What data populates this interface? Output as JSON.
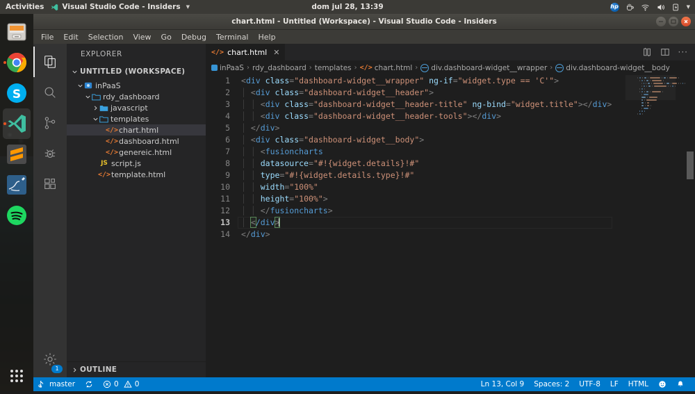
{
  "desktop": {
    "topbar": {
      "activities": "Activities",
      "app_name": "Visual Studio Code - Insiders",
      "app_icon": "vscode-icon",
      "caret_icon": "chevron-down-icon",
      "clock": "dom jul 28, 13:39",
      "indicators": [
        {
          "name": "hp-logo-icon",
          "label": "hp"
        },
        {
          "name": "coffee-cup-icon",
          "label": ""
        },
        {
          "name": "wifi-icon",
          "label": ""
        },
        {
          "name": "volume-icon",
          "label": ""
        },
        {
          "name": "battery-icon",
          "label": ""
        },
        {
          "name": "chevron-down-icon",
          "label": ""
        }
      ]
    },
    "dock": {
      "items": [
        {
          "name": "files-nautilus",
          "label": "Files",
          "active": false,
          "running": false
        },
        {
          "name": "google-chrome",
          "label": "Google Chrome",
          "active": false,
          "running": true
        },
        {
          "name": "skype",
          "label": "Skype",
          "active": false,
          "running": false
        },
        {
          "name": "visual-studio-code-insiders",
          "label": "Visual Studio Code - Insiders",
          "active": true,
          "running": true
        },
        {
          "name": "sublime-text",
          "label": "Sublime Text",
          "active": false,
          "running": false
        },
        {
          "name": "mysql-workbench",
          "label": "MySQL Workbench",
          "active": false,
          "running": false
        },
        {
          "name": "spotify",
          "label": "Spotify",
          "active": false,
          "running": false
        }
      ],
      "show_apps_label": "Show Applications"
    }
  },
  "window": {
    "title": "chart.html - Untitled (Workspace) - Visual Studio Code - Insiders",
    "controls": {
      "minimize": "–",
      "maximize": "□",
      "close": "×"
    }
  },
  "menubar": {
    "items": [
      "File",
      "Edit",
      "Selection",
      "View",
      "Go",
      "Debug",
      "Terminal",
      "Help"
    ]
  },
  "activitybar": {
    "items": [
      {
        "name": "explorer",
        "icon": "files-icon",
        "active": true
      },
      {
        "name": "search",
        "icon": "search-icon",
        "active": false
      },
      {
        "name": "source-control",
        "icon": "source-control-icon",
        "active": false
      },
      {
        "name": "debug",
        "icon": "debug-icon",
        "active": false
      },
      {
        "name": "extensions",
        "icon": "extensions-icon",
        "active": false
      }
    ],
    "manage": {
      "icon": "gear-icon",
      "badge": "1"
    }
  },
  "sidebar": {
    "title": "EXPLORER",
    "workspace": {
      "label": "UNTITLED (WORKSPACE)",
      "expanded": true
    },
    "tree": [
      {
        "label": "inPaaS",
        "depth": 1,
        "type": "project",
        "expanded": true,
        "selected": false
      },
      {
        "label": "rdy_dashboard",
        "depth": 2,
        "type": "folder",
        "expanded": true,
        "selected": false
      },
      {
        "label": "javascript",
        "depth": 3,
        "type": "folder",
        "expanded": false,
        "selected": false
      },
      {
        "label": "templates",
        "depth": 3,
        "type": "folder",
        "expanded": true,
        "selected": false
      },
      {
        "label": "chart.html",
        "depth": 4,
        "type": "html",
        "expanded": null,
        "selected": true
      },
      {
        "label": "dashboard.html",
        "depth": 4,
        "type": "html",
        "expanded": null,
        "selected": false
      },
      {
        "label": "genereic.html",
        "depth": 4,
        "type": "html",
        "expanded": null,
        "selected": false
      },
      {
        "label": "script.js",
        "depth": 3,
        "type": "js",
        "expanded": null,
        "selected": false
      },
      {
        "label": "template.html",
        "depth": 3,
        "type": "html",
        "expanded": null,
        "selected": false
      }
    ],
    "outline": {
      "label": "OUTLINE",
      "expanded": false
    }
  },
  "editor": {
    "tabs": [
      {
        "label": "chart.html",
        "icon": "html-file-icon",
        "active": true,
        "close_icon": "close-icon"
      }
    ],
    "actions": [
      {
        "name": "split-editor-orientation-icon"
      },
      {
        "name": "split-editor-icon"
      },
      {
        "name": "more-actions-icon",
        "label": "···"
      }
    ],
    "breadcrumbs": [
      {
        "label": "inPaaS",
        "icon": "project-icon"
      },
      {
        "label": "rdy_dashboard",
        "icon": ""
      },
      {
        "label": "templates",
        "icon": ""
      },
      {
        "label": "chart.html",
        "icon": "html-file-icon"
      },
      {
        "label": "div.dashboard-widget__wrapper",
        "icon": "symbol-field-icon"
      },
      {
        "label": "div.dashboard-widget__body",
        "icon": "symbol-field-icon"
      }
    ],
    "lines": [
      {
        "n": "1",
        "indent": 0,
        "tokens": [
          [
            "pun",
            "<"
          ],
          [
            "tag",
            "div"
          ],
          [
            "txt",
            " "
          ],
          [
            "attr",
            "class"
          ],
          [
            "pun",
            "="
          ],
          [
            "str",
            "\"dashboard-widget__wrapper\""
          ],
          [
            "txt",
            " "
          ],
          [
            "attr",
            "ng-if"
          ],
          [
            "pun",
            "="
          ],
          [
            "str",
            "\"widget.type == 'C'\""
          ],
          [
            "pun",
            ">"
          ]
        ]
      },
      {
        "n": "2",
        "indent": 1,
        "tokens": [
          [
            "pun",
            "<"
          ],
          [
            "tag",
            "div"
          ],
          [
            "txt",
            " "
          ],
          [
            "attr",
            "class"
          ],
          [
            "pun",
            "="
          ],
          [
            "str",
            "\"dashboard-widget__header\""
          ],
          [
            "pun",
            ">"
          ]
        ]
      },
      {
        "n": "3",
        "indent": 2,
        "tokens": [
          [
            "pun",
            "<"
          ],
          [
            "tag",
            "div"
          ],
          [
            "txt",
            " "
          ],
          [
            "attr",
            "class"
          ],
          [
            "pun",
            "="
          ],
          [
            "str",
            "\"dashboard-widget__header-title\""
          ],
          [
            "txt",
            " "
          ],
          [
            "attr",
            "ng-bind"
          ],
          [
            "pun",
            "="
          ],
          [
            "str",
            "\"widget.title\""
          ],
          [
            "pun",
            ">"
          ],
          [
            "pun",
            "</"
          ],
          [
            "tag",
            "div"
          ],
          [
            "pun",
            ">"
          ]
        ]
      },
      {
        "n": "4",
        "indent": 2,
        "tokens": [
          [
            "pun",
            "<"
          ],
          [
            "tag",
            "div"
          ],
          [
            "txt",
            " "
          ],
          [
            "attr",
            "class"
          ],
          [
            "pun",
            "="
          ],
          [
            "str",
            "\"dashboard-widget__header-tools\""
          ],
          [
            "pun",
            ">"
          ],
          [
            "pun",
            "</"
          ],
          [
            "tag",
            "div"
          ],
          [
            "pun",
            ">"
          ]
        ]
      },
      {
        "n": "5",
        "indent": 1,
        "tokens": [
          [
            "pun",
            "</"
          ],
          [
            "tag",
            "div"
          ],
          [
            "pun",
            ">"
          ]
        ]
      },
      {
        "n": "6",
        "indent": 1,
        "tokens": [
          [
            "pun",
            "<"
          ],
          [
            "tag",
            "div"
          ],
          [
            "txt",
            " "
          ],
          [
            "attr",
            "class"
          ],
          [
            "pun",
            "="
          ],
          [
            "str",
            "\"dashboard-widget__body\""
          ],
          [
            "pun",
            ">"
          ]
        ]
      },
      {
        "n": "7",
        "indent": 2,
        "tokens": [
          [
            "pun",
            "<"
          ],
          [
            "tag",
            "fusioncharts"
          ]
        ]
      },
      {
        "n": "8",
        "indent": 2,
        "tokens": [
          [
            "attr",
            "datasource"
          ],
          [
            "pun",
            "="
          ],
          [
            "str",
            "\"#!{widget.details}!#\""
          ]
        ]
      },
      {
        "n": "9",
        "indent": 2,
        "tokens": [
          [
            "attr",
            "type"
          ],
          [
            "pun",
            "="
          ],
          [
            "str",
            "\"#!{widget.details.type}!#\""
          ]
        ]
      },
      {
        "n": "10",
        "indent": 2,
        "tokens": [
          [
            "attr",
            "width"
          ],
          [
            "pun",
            "="
          ],
          [
            "str",
            "\"100%\""
          ]
        ]
      },
      {
        "n": "11",
        "indent": 2,
        "tokens": [
          [
            "attr",
            "height"
          ],
          [
            "pun",
            "="
          ],
          [
            "str",
            "\"100%\""
          ],
          [
            "pun",
            ">"
          ]
        ]
      },
      {
        "n": "12",
        "indent": 2,
        "tokens": [
          [
            "pun",
            "</"
          ],
          [
            "tag",
            "fusioncharts"
          ],
          [
            "pun",
            ">"
          ]
        ]
      },
      {
        "n": "13",
        "indent": 1,
        "tokens": [
          [
            "match",
            "<"
          ],
          [
            "tag",
            "/div"
          ],
          [
            "match",
            ">"
          ],
          [
            "caret",
            ""
          ]
        ],
        "current": true
      },
      {
        "n": "14",
        "indent": 0,
        "tokens": [
          [
            "pun",
            "</"
          ],
          [
            "tag",
            "div"
          ],
          [
            "pun",
            ">"
          ]
        ]
      }
    ]
  },
  "statusbar": {
    "left": [
      {
        "name": "git-branch",
        "icon": "source-control-icon",
        "label": "master"
      },
      {
        "name": "sync-changes",
        "icon": "sync-icon",
        "label": ""
      },
      {
        "name": "problems",
        "icon": "error-icon",
        "label": "0",
        "icon2": "warning-icon",
        "label2": "0"
      }
    ],
    "right": [
      {
        "name": "cursor-position",
        "label": "Ln 13, Col 9"
      },
      {
        "name": "indentation",
        "label": "Spaces: 2"
      },
      {
        "name": "encoding",
        "label": "UTF-8"
      },
      {
        "name": "end-of-line",
        "label": "LF"
      },
      {
        "name": "language-mode",
        "label": "HTML"
      },
      {
        "name": "feedback-smiley-icon",
        "label": ""
      },
      {
        "name": "notifications-bell-icon",
        "label": ""
      }
    ]
  },
  "colors": {
    "accent": "#007acc",
    "editor_bg": "#1e1e1e",
    "sidebar_bg": "#252526",
    "activitybar_bg": "#333333",
    "titlebar_bg": "#3c3b37",
    "close_button": "#d8492a"
  }
}
